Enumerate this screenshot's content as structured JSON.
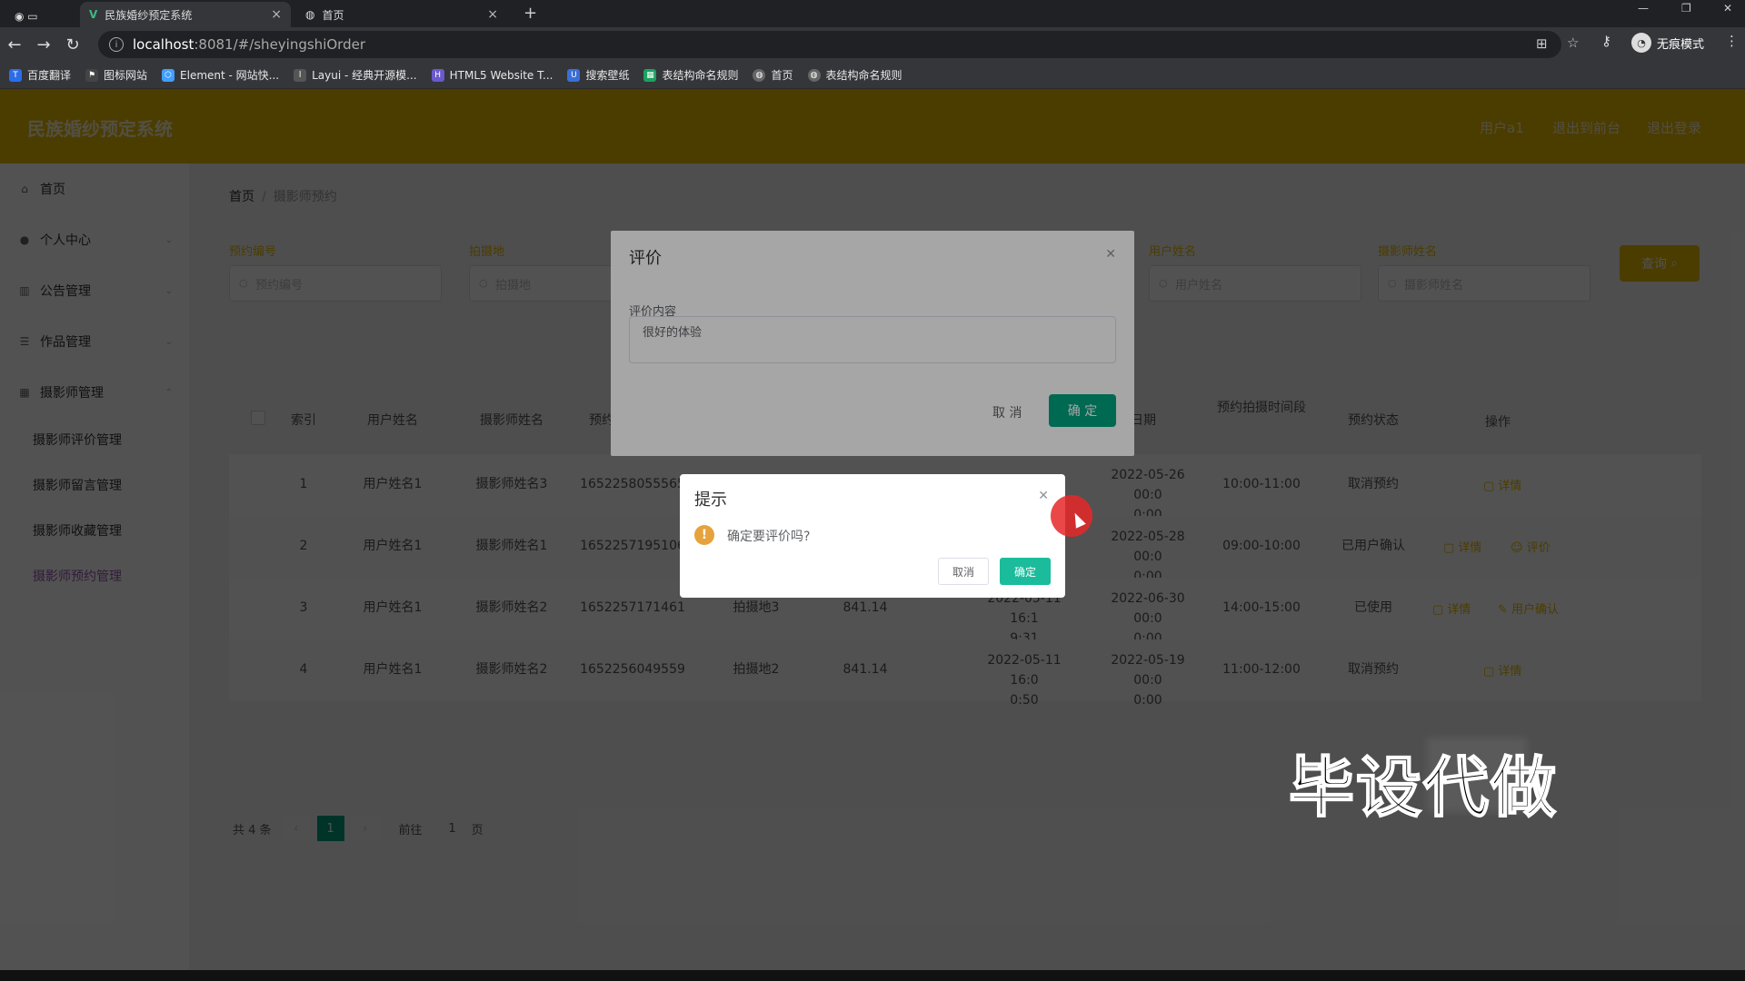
{
  "browser": {
    "tabs": [
      {
        "title": "民族婚纱预定系统"
      },
      {
        "title": "首页"
      }
    ],
    "url_host": "localhost",
    "url_path": ":8081/#/sheyingshiOrder",
    "profile": "无痕模式",
    "bookmarks": [
      {
        "label": "百度翻译",
        "color": "#2b6de8"
      },
      {
        "label": "图标网站",
        "color": "#444444"
      },
      {
        "label": "Element - 网站快...",
        "color": "#409eff"
      },
      {
        "label": "Layui - 经典开源模...",
        "color": "#555555"
      },
      {
        "label": "HTML5 Website T...",
        "color": "#6a5acd"
      },
      {
        "label": "搜索壁纸",
        "color": "#3b6fd8"
      },
      {
        "label": "表结构命名规则",
        "color": "#1aa260"
      },
      {
        "label": "首页",
        "color": "#666666"
      },
      {
        "label": "表结构命名规则",
        "color": "#666666"
      }
    ]
  },
  "header": {
    "title": "民族婚纱预定系统",
    "user": "用户a1",
    "back_to_home": "退出到前台",
    "logout": "退出登录",
    "color": "#e6b800"
  },
  "sidebar": {
    "items": [
      {
        "label": "首页"
      },
      {
        "label": "个人中心"
      },
      {
        "label": "公告管理"
      },
      {
        "label": "作品管理"
      },
      {
        "label": "摄影师管理"
      }
    ],
    "subitems": [
      {
        "label": "摄影师评价管理"
      },
      {
        "label": "摄影师留言管理"
      },
      {
        "label": "摄影师收藏管理"
      },
      {
        "label": "摄影师预约管理"
      }
    ]
  },
  "breadcrumb": {
    "home": "首页",
    "current": "摄影师预约"
  },
  "search": {
    "fields": [
      {
        "label": "预约编号",
        "placeholder": "预约编号"
      },
      {
        "label": "拍摄地",
        "placeholder": "拍摄地"
      },
      {
        "label": "用户姓名",
        "placeholder": "用户姓名"
      },
      {
        "label": "摄影师姓名",
        "placeholder": "摄影师姓名"
      }
    ],
    "query_button": "查询"
  },
  "table": {
    "headers": [
      "索引",
      "用户姓名",
      "摄影师姓名",
      "预约",
      "日期",
      "预约拍摄时间段",
      "预约状态",
      "操作"
    ],
    "rows": [
      {
        "index": "1",
        "user": "用户姓名1",
        "photographer": "摄影师姓名3",
        "order_no": "1652258055565",
        "place": "",
        "price": "",
        "created": "",
        "date_line1": "2022-05-26 00:0",
        "date_line2": "0:00",
        "slot": "10:00-11:00",
        "status": "取消预约",
        "ops": [
          "详情"
        ]
      },
      {
        "index": "2",
        "user": "用户姓名1",
        "photographer": "摄影师姓名1",
        "order_no": "1652257195106",
        "place": "",
        "price": "",
        "created": "",
        "date_line1": "2022-05-28 00:0",
        "date_line2": "0:00",
        "slot": "09:00-10:00",
        "status": "已用户确认",
        "ops": [
          "详情",
          "评价"
        ]
      },
      {
        "index": "3",
        "user": "用户姓名1",
        "photographer": "摄影师姓名2",
        "order_no": "1652257171461",
        "place": "拍摄地3",
        "price": "841.14",
        "created_line1": "2022-05-11 16:1",
        "created_line2": "9:31",
        "date_line1": "2022-06-30 00:0",
        "date_line2": "0:00",
        "slot": "14:00-15:00",
        "status": "已使用",
        "ops": [
          "详情",
          "用户确认"
        ]
      },
      {
        "index": "4",
        "user": "用户姓名1",
        "photographer": "摄影师姓名2",
        "order_no": "1652256049559",
        "place": "拍摄地2",
        "price": "841.14",
        "created_line1": "2022-05-11 16:0",
        "created_line2": "0:50",
        "date_line1": "2022-05-19 00:0",
        "date_line2": "0:00",
        "slot": "11:00-12:00",
        "status": "取消预约",
        "ops": [
          "详情"
        ]
      }
    ]
  },
  "pager": {
    "total": "共 4 条",
    "current": "1",
    "goto": "前往",
    "goto_value": "1",
    "page_unit": "页"
  },
  "eval_dialog": {
    "title": "评价",
    "content_label": "评价内容",
    "content_value": "很好的体验",
    "cancel": "取 消",
    "ok": "确 定"
  },
  "confirm_box": {
    "title": "提示",
    "message": "确定要评价吗?",
    "cancel": "取消",
    "ok": "确定"
  },
  "watermark": {
    "text": "毕设代做"
  }
}
